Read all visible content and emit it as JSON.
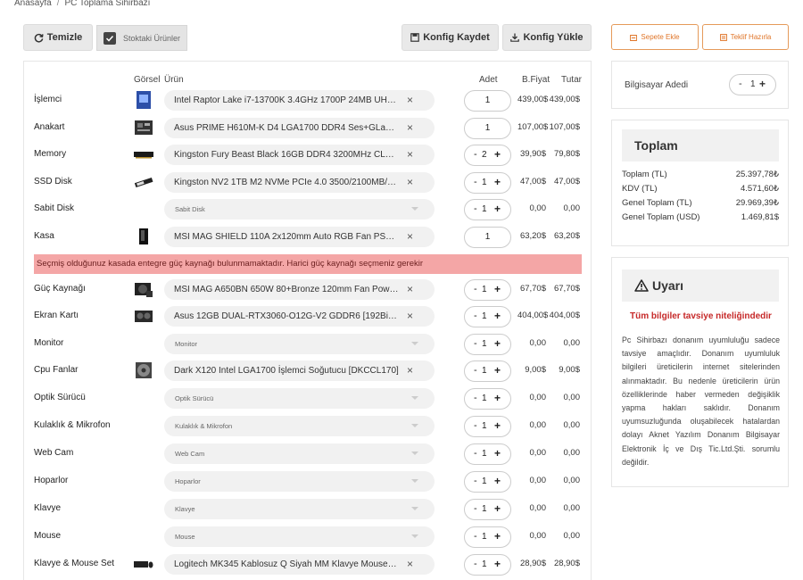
{
  "breadcrumb": {
    "home": "Anasayfa",
    "current": "PC Toplama Sihirbazı"
  },
  "toolbar": {
    "clear_label": "Temizle",
    "stock_label": "Stoktaki Ürünler",
    "save_label": "Konfig Kaydet",
    "load_label": "Konfig Yükle",
    "cart_label": "Sepete Ekle",
    "quote_label": "Teklif Hazırla"
  },
  "table": {
    "headers": {
      "image": "Görsel",
      "product": "Ürün",
      "qty": "Adet",
      "unit_price": "B.Fiyat",
      "total": "Tutar"
    },
    "rows": [
      {
        "category": "İşlemci",
        "product": "Intel Raptor Lake i7-13700K 3.4GHz 1700P 24MB UHD V...",
        "selected": true,
        "qty": "1",
        "stepper": false,
        "unit_price": "439,00$",
        "total": "439,00$",
        "icon": "cpu-box-icon"
      },
      {
        "category": "Anakart",
        "product": "Asus PRIME H610M-K D4 LGA1700 DDR4 Ses+GLan HDM...",
        "selected": true,
        "qty": "1",
        "stepper": false,
        "unit_price": "107,00$",
        "total": "107,00$",
        "icon": "motherboard-icon"
      },
      {
        "category": "Memory",
        "product": "Kingston Fury Beast Black 16GB DDR4 3200MHz CL16 P...",
        "selected": true,
        "qty": "2",
        "stepper": true,
        "unit_price": "39,90$",
        "total": "79,80$",
        "icon": "ram-icon"
      },
      {
        "category": "SSD Disk",
        "product": "Kingston NV2 1TB M2 NVMe PCIe 4.0 3500/2100MB/s (S...",
        "selected": true,
        "qty": "1",
        "stepper": true,
        "unit_price": "47,00$",
        "total": "47,00$",
        "icon": "ssd-icon"
      },
      {
        "category": "Sabit Disk",
        "product": "Sabit Disk",
        "selected": false,
        "qty": "1",
        "stepper": true,
        "unit_price": "0,00",
        "total": "0,00",
        "icon": ""
      },
      {
        "category": "Kasa",
        "product": "MSI MAG SHIELD 110A 2x120mm Auto RGB Fan PSU Yok...",
        "selected": true,
        "qty": "1",
        "stepper": false,
        "unit_price": "63,20$",
        "total": "63,20$",
        "icon": "case-icon"
      },
      {
        "category": "Güç Kaynağı",
        "product": "MSI MAG A650BN 650W 80+Bronze 120mm Fan Power S...",
        "selected": true,
        "qty": "1",
        "stepper": true,
        "unit_price": "67,70$",
        "total": "67,70$",
        "icon": "psu-icon"
      },
      {
        "category": "Ekran Kartı",
        "product": "Asus 12GB DUAL-RTX3060-O12G-V2 GDDR6 [192Bit] HD...",
        "selected": true,
        "qty": "1",
        "stepper": true,
        "unit_price": "404,00$",
        "total": "404,00$",
        "icon": "gpu-icon"
      },
      {
        "category": "Monitor",
        "product": "Monitor",
        "selected": false,
        "qty": "1",
        "stepper": true,
        "unit_price": "0,00",
        "total": "0,00",
        "icon": ""
      },
      {
        "category": "Cpu Fanlar",
        "product": "Dark X120 Intel LGA1700 İşlemci Soğutucu [DKCCL170]",
        "selected": true,
        "qty": "1",
        "stepper": true,
        "unit_price": "9,00$",
        "total": "9,00$",
        "icon": "cpu-fan-icon"
      },
      {
        "category": "Optik Sürücü",
        "product": "Optik Sürücü",
        "selected": false,
        "qty": "1",
        "stepper": true,
        "unit_price": "0,00",
        "total": "0,00",
        "icon": ""
      },
      {
        "category": "Kulaklık & Mikrofon",
        "product": "Kulaklık & Mikrofon",
        "selected": false,
        "qty": "1",
        "stepper": true,
        "unit_price": "0,00",
        "total": "0,00",
        "icon": ""
      },
      {
        "category": "Web Cam",
        "product": "Web Cam",
        "selected": false,
        "qty": "1",
        "stepper": true,
        "unit_price": "0,00",
        "total": "0,00",
        "icon": ""
      },
      {
        "category": "Hoparlor",
        "product": "Hoparlor",
        "selected": false,
        "qty": "1",
        "stepper": true,
        "unit_price": "0,00",
        "total": "0,00",
        "icon": ""
      },
      {
        "category": "Klavye",
        "product": "Klavye",
        "selected": false,
        "qty": "1",
        "stepper": true,
        "unit_price": "0,00",
        "total": "0,00",
        "icon": ""
      },
      {
        "category": "Mouse",
        "product": "Mouse",
        "selected": false,
        "qty": "1",
        "stepper": true,
        "unit_price": "0,00",
        "total": "0,00",
        "icon": ""
      },
      {
        "category": "Klavye & Mouse Set",
        "product": "Logitech MK345 Kablosuz Q Siyah MM Klavye Mouse Se...",
        "selected": true,
        "qty": "1",
        "stepper": true,
        "unit_price": "28,90$",
        "total": "28,90$",
        "icon": "keyboard-mouse-icon"
      }
    ]
  },
  "alert": {
    "text": "Seçmiş olduğunuz kasada entegre güç kaynağı bulunmamaktadır. Harici güç kaynağı seçmeniz gerekir"
  },
  "pc_count": {
    "label": "Bilgisayar Adedi",
    "value": "1"
  },
  "totals": {
    "title": "Toplam",
    "lines": [
      {
        "label": "Toplam (TL)",
        "value": "25.397,78₺"
      },
      {
        "label": "KDV (TL)",
        "value": "4.571,60₺"
      },
      {
        "label": "Genel Toplam (TL)",
        "value": "29.969,39₺"
      },
      {
        "label": "Genel Toplam (USD)",
        "value": "1.469,81$"
      }
    ]
  },
  "warning": {
    "title": "Uyarı",
    "subtitle": "Tüm bilgiler tavsiye niteliğindedir",
    "body": "Pc Sihirbazı donanım uyumluluğu sadece tavsiye amaçlıdır. Donanım uyumluluk bilgileri üreticilerin internet sitelerinden alınmaktadır. Bu nedenle üreticilerin ürün özelliklerinde haber vermeden değişiklik yapma hakları saklıdır. Donanım uyumsuzluğunda oluşabilecek hatalardan dolayı Aknet Yazılım Donanım Bilgisayar Elektronik İç ve Dış Tic.Ltd.Şti. sorumlu değildir."
  },
  "colors": {
    "accent_orange": "#e0762a",
    "alert_bg": "#f4a6a6",
    "warning_red": "#c62828"
  }
}
